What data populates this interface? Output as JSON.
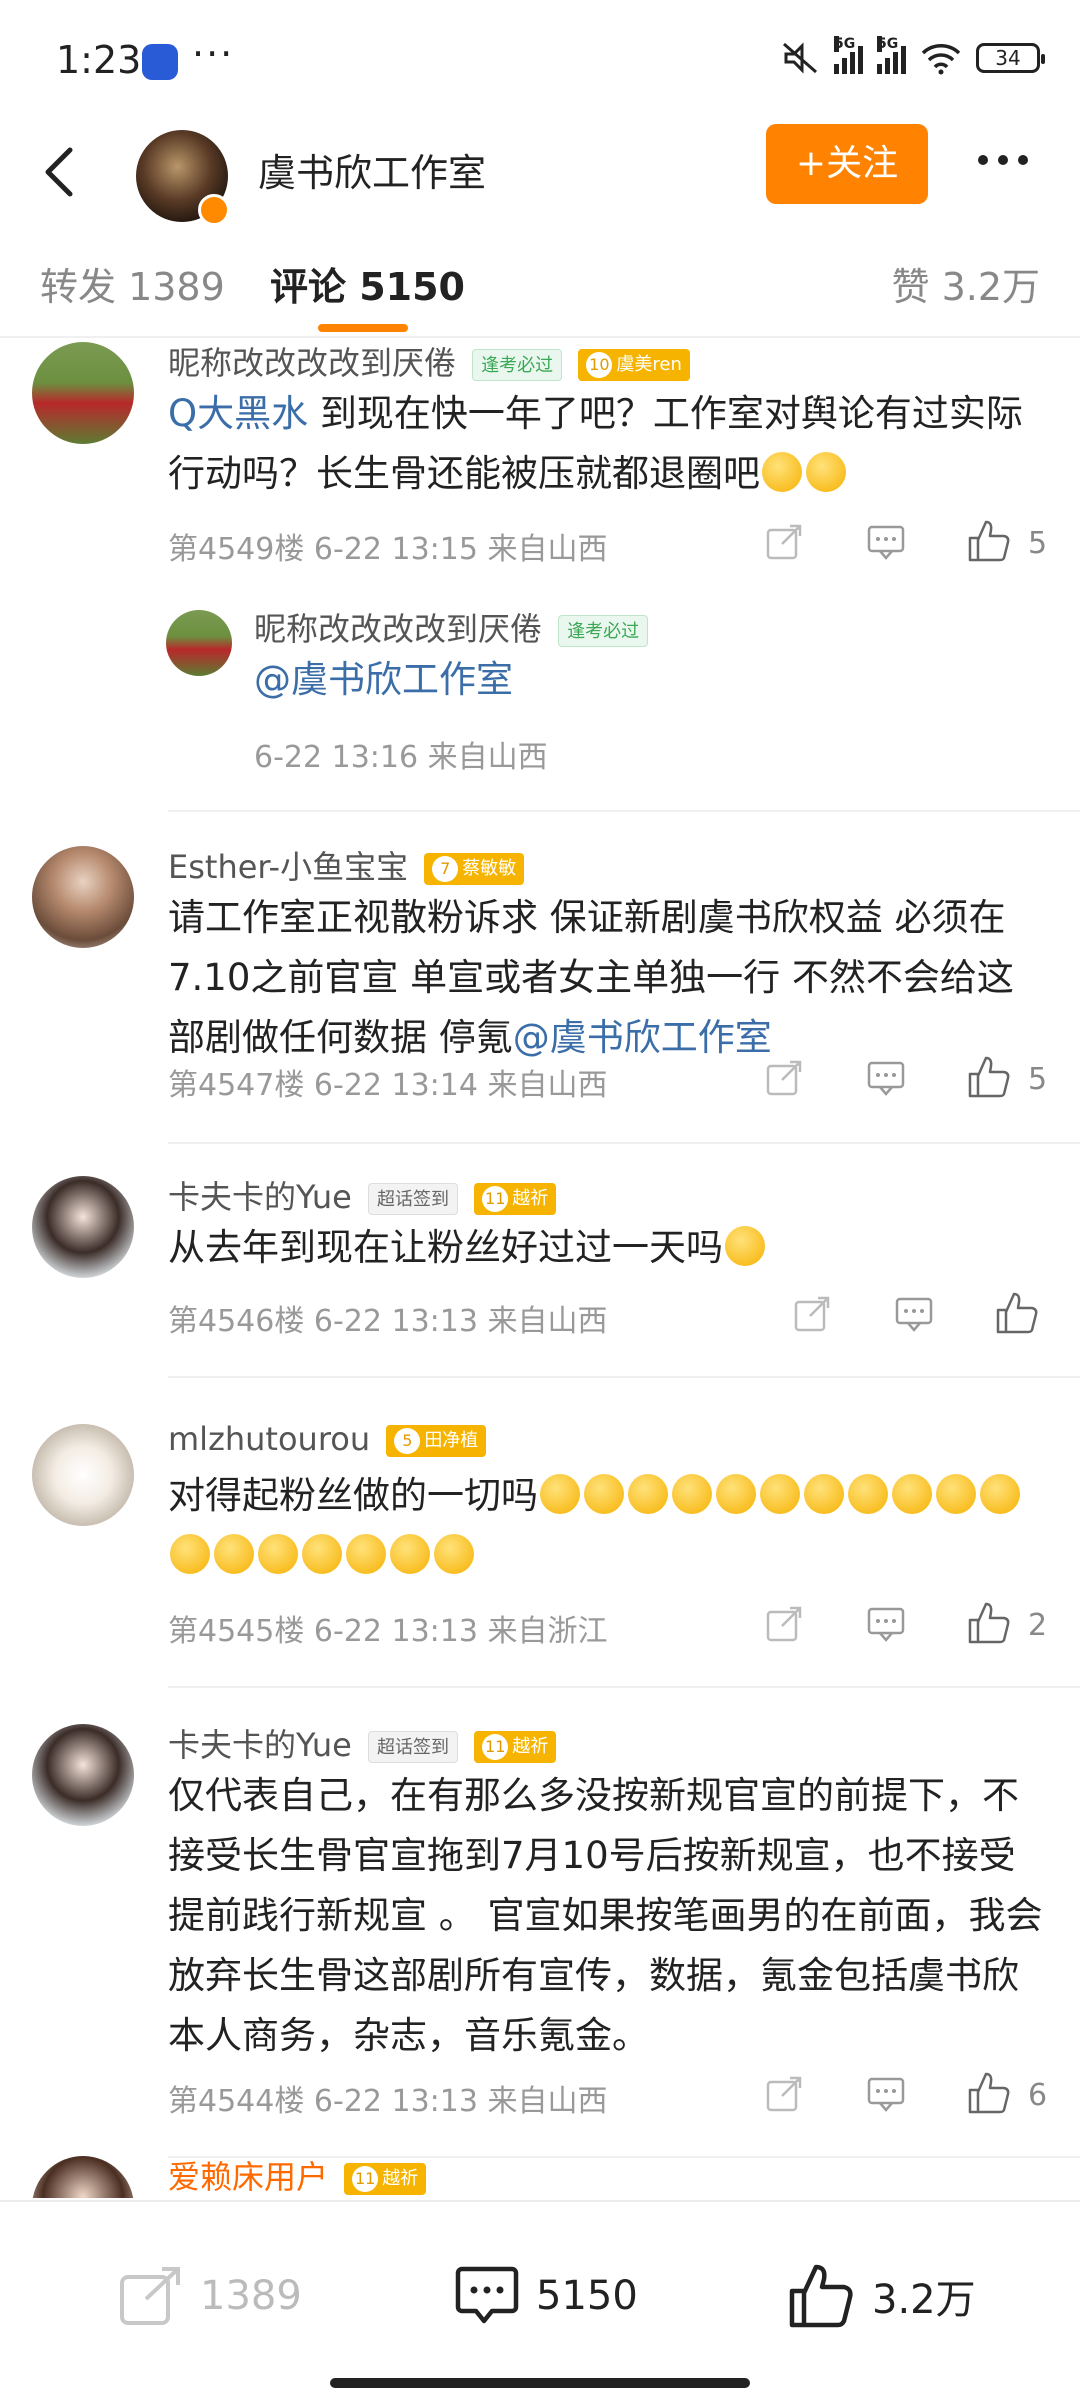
{
  "status_bar": {
    "time": "1:23",
    "dots": "···",
    "net1": "5G",
    "net2": "5G",
    "battery": "34"
  },
  "header": {
    "title": "虞书欣工作室",
    "follow_label": "+关注"
  },
  "tabs": [
    {
      "label": "转发 1389"
    },
    {
      "label": "评论 5150"
    },
    {
      "label": "赞 3.2万"
    }
  ],
  "comments": [
    {
      "username": "昵称改改改改到厌倦",
      "badges": [
        "逢考必过",
        "虞美ren"
      ],
      "badge_level": "10",
      "text_link": "Q大黑水",
      "text": " 到现在快一年了吧？工作室对舆论有过实际行动吗？长生骨还能被压就都退圈吧",
      "meta": "第4549楼  6-22 13:15  来自山西",
      "likes": "5",
      "reply": {
        "username": "昵称改改改改到厌倦",
        "badge": "逢考必过",
        "text_link": "@虞书欣工作室",
        "meta": "6-22 13:16  来自山西"
      }
    },
    {
      "username": "Esther-小鱼宝宝",
      "badge_level": "7",
      "badge": "蔡敏敏",
      "text": "请工作室正视散粉诉求 保证新剧虞书欣权益 必须在7.10之前官宣 单宣或者女主单独一行 不然不会给这部剧做任何数据 停氪",
      "text_link": "@虞书欣工作室",
      "meta": "第4547楼  6-22 13:14  来自山西",
      "likes": "5"
    },
    {
      "username": "卡夫卡的Yue",
      "badge_gray": "超话签到",
      "badge_level": "11",
      "badge": "越祈",
      "text": "从去年到现在让粉丝好过过一天吗",
      "meta": "第4546楼  6-22 13:13  来自山西",
      "likes": ""
    },
    {
      "username": "mlzhutourou",
      "badge_level": "5",
      "badge": "田净植",
      "text": "对得起粉丝做的一切吗",
      "meta": "第4545楼  6-22 13:13  来自浙江",
      "likes": "2"
    },
    {
      "username": "卡夫卡的Yue",
      "badge_gray": "超话签到",
      "badge_level": "11",
      "badge": "越祈",
      "text": "仅代表自己，在有那么多没按新规官宣的前提下，不接受长生骨官宣拖到7月10号后按新规宣，也不接受提前践行新规宣 。 官宣如果按笔画男的在前面，我会放弃长生骨这部剧所有宣传，数据，氪金包括虞书欣本人商务，杂志，音乐氪金。",
      "meta": "第4544楼  6-22 13:13  来自山西",
      "likes": "6"
    },
    {
      "username": "爱赖床用户",
      "badge_level": "11",
      "badge": "越祈"
    }
  ],
  "bottom_bar": {
    "repost": "1389",
    "comment": "5150",
    "like": "3.2万"
  },
  "colors": {
    "accent": "#ff8200",
    "link": "#3b6ea8"
  }
}
